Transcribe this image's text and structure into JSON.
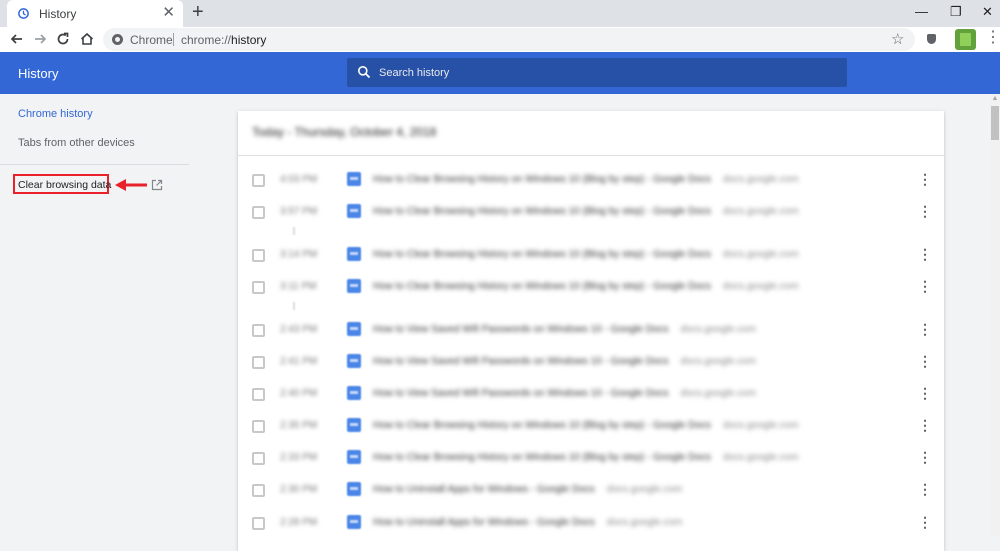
{
  "browser": {
    "tab_title": "History",
    "tab_close": "✕",
    "new_tab": "+",
    "window_controls": {
      "minimize": "—",
      "restore": "❐",
      "close": "✕"
    },
    "site_name": "Chrome",
    "url_scheme": "chrome://",
    "url_path": "history",
    "icons": [
      "back-icon",
      "forward-icon",
      "reload-icon",
      "home-icon",
      "star-icon",
      "extension-icon",
      "profile-avatar",
      "menu-icon"
    ]
  },
  "header": {
    "title": "History",
    "search_placeholder": "Search history"
  },
  "sidebar": {
    "items": [
      {
        "label": "Chrome history",
        "active": true
      },
      {
        "label": "Tabs from other devices",
        "active": false
      }
    ],
    "clear_label": "Clear browsing data"
  },
  "history": {
    "date_heading": "Today - Thursday, October 4, 2018",
    "rows": [
      {
        "time": "4:03 PM",
        "title": "How to Clear Browsing History on Windows 10 (Blog by step) - Google Docs",
        "domain": "docs.google.com"
      },
      {
        "time": "3:57 PM",
        "title": "How to Clear Browsing History on Windows 10 (Blog by step) - Google Docs",
        "domain": "docs.google.com"
      },
      {
        "time": "3:14 PM",
        "title": "How to Clear Browsing History on Windows 10 (Blog by step) - Google Docs",
        "domain": "docs.google.com"
      },
      {
        "time": "3:11 PM",
        "title": "How to Clear Browsing History on Windows 10 (Blog by step) - Google Docs",
        "domain": "docs.google.com"
      },
      {
        "time": "2:43 PM",
        "title": "How to View Saved Wifi Passwords on Windows 10 - Google Docs",
        "domain": "docs.google.com"
      },
      {
        "time": "2:41 PM",
        "title": "How to View Saved Wifi Passwords on Windows 10 - Google Docs",
        "domain": "docs.google.com"
      },
      {
        "time": "2:40 PM",
        "title": "How to View Saved Wifi Passwords on Windows 10 - Google Docs",
        "domain": "docs.google.com"
      },
      {
        "time": "2:35 PM",
        "title": "How to Clear Browsing History on Windows 10 (Blog by step) - Google Docs",
        "domain": "docs.google.com"
      },
      {
        "time": "2:33 PM",
        "title": "How to Clear Browsing History on Windows 10 (Blog by step) - Google Docs",
        "domain": "docs.google.com"
      },
      {
        "time": "2:30 PM",
        "title": "How to Uninstall Apps for Windows - Google Docs",
        "domain": "docs.google.com"
      },
      {
        "time": "2:28 PM",
        "title": "How to Uninstall Apps for Windows - Google Docs",
        "domain": "docs.google.com"
      }
    ]
  },
  "colors": {
    "header": "#3367d6",
    "accent": "#3367d6",
    "highlight": "#e8212a"
  }
}
